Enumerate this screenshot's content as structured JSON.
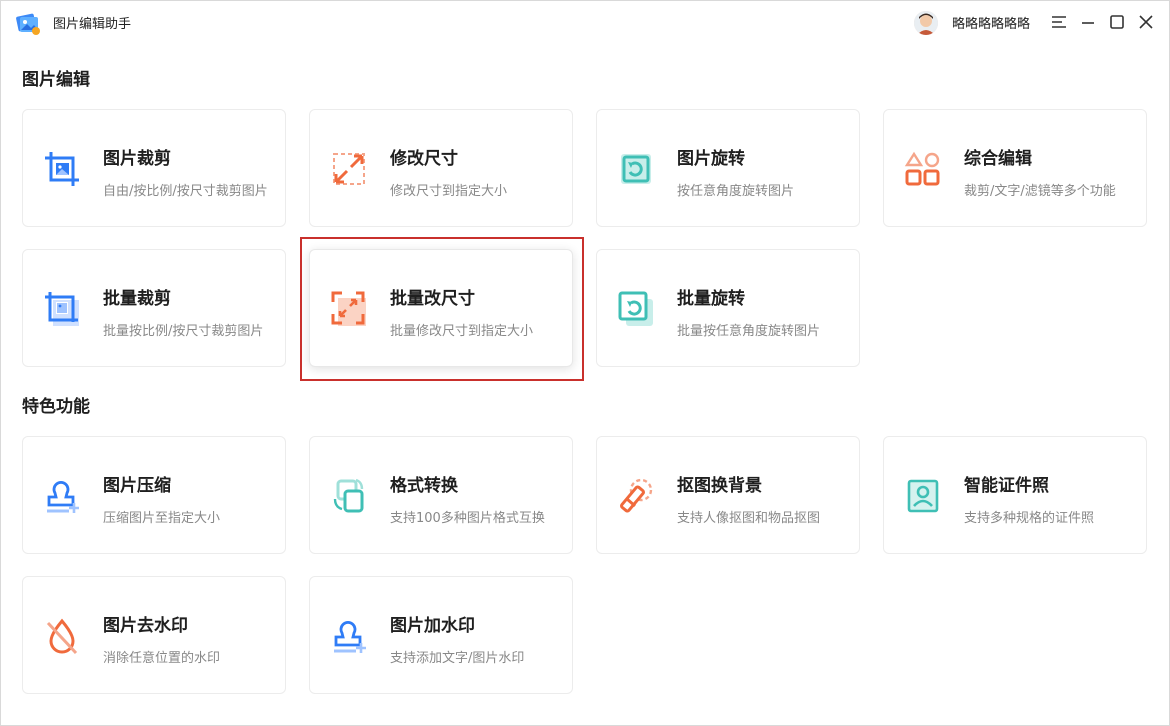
{
  "app": {
    "title": "图片编辑助手",
    "username": "略略略略略略"
  },
  "sections": {
    "edit": "图片编辑",
    "features": "特色功能"
  },
  "cards": {
    "crop": {
      "title": "图片裁剪",
      "desc": "自由/按比例/按尺寸裁剪图片",
      "icon": "crop-icon"
    },
    "resize": {
      "title": "修改尺寸",
      "desc": "修改尺寸到指定大小",
      "icon": "resize-icon"
    },
    "rotate": {
      "title": "图片旋转",
      "desc": "按任意角度旋转图片",
      "icon": "rotate-icon"
    },
    "combo": {
      "title": "综合编辑",
      "desc": "裁剪/文字/滤镜等多个功能",
      "icon": "shapes-icon"
    },
    "batch_crop": {
      "title": "批量裁剪",
      "desc": "批量按比例/按尺寸裁剪图片",
      "icon": "batch-crop-icon"
    },
    "batch_resize": {
      "title": "批量改尺寸",
      "desc": "批量修改尺寸到指定大小",
      "icon": "batch-resize-icon"
    },
    "batch_rotate": {
      "title": "批量旋转",
      "desc": "批量按任意角度旋转图片",
      "icon": "batch-rotate-icon"
    },
    "compress": {
      "title": "图片压缩",
      "desc": "压缩图片至指定大小",
      "icon": "stamp-icon"
    },
    "convert": {
      "title": "格式转换",
      "desc": "支持100多种图片格式互换",
      "icon": "convert-icon"
    },
    "cutout": {
      "title": "抠图换背景",
      "desc": "支持人像抠图和物品抠图",
      "icon": "eraser-icon"
    },
    "id_photo": {
      "title": "智能证件照",
      "desc": "支持多种规格的证件照",
      "icon": "id-photo-icon"
    },
    "remove_wm": {
      "title": "图片去水印",
      "desc": "消除任意位置的水印",
      "icon": "drop-slash-icon"
    },
    "add_wm": {
      "title": "图片加水印",
      "desc": "支持添加文字/图片水印",
      "icon": "stamp-add-icon"
    }
  },
  "colors": {
    "blue": "#2f7cf6",
    "orange": "#f06a3c",
    "teal": "#3fbfb5",
    "highlight": "#c9302c"
  }
}
